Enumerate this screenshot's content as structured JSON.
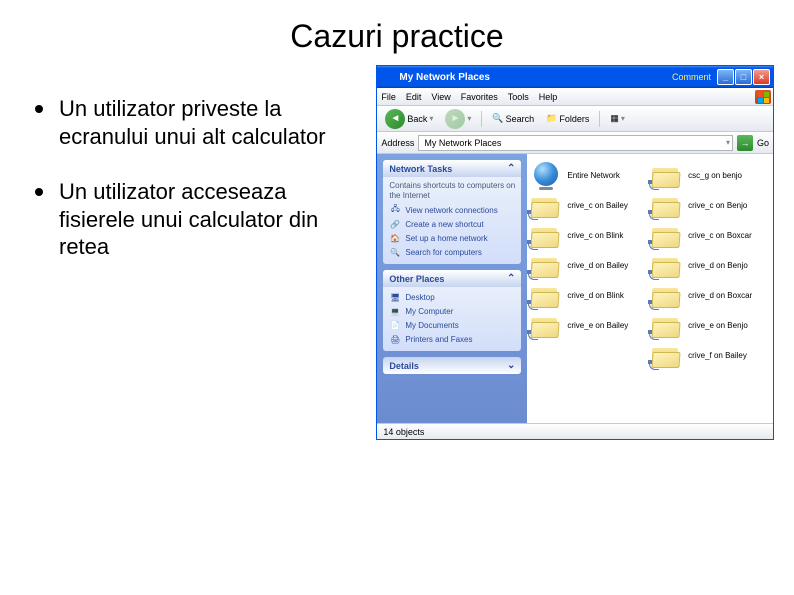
{
  "slide": {
    "title": "Cazuri practice",
    "bullets": [
      "Un utilizator priveste la ecranului unui alt calculator",
      "Un utilizator acceseaza fisierele unui calculator din retea"
    ]
  },
  "window": {
    "title": "My Network Places",
    "comment": "Comment",
    "min": "_",
    "max": "□",
    "close": "×"
  },
  "menubar": [
    "File",
    "Edit",
    "View",
    "Favorites",
    "Tools",
    "Help"
  ],
  "toolbar": {
    "back": "Back",
    "search": "Search",
    "folders": "Folders"
  },
  "addressbar": {
    "label": "Address",
    "value": "My Network Places",
    "go": "Go"
  },
  "sidebar": {
    "network_tasks": {
      "title": "Network Tasks",
      "desc": "Contains shortcuts to computers on the Internet",
      "links": [
        "View network connections",
        "Create a new shortcut",
        "Set up a home network",
        "Search for computers"
      ]
    },
    "other_places": {
      "title": "Other Places",
      "links": [
        "Desktop",
        "My Computer",
        "My Documents",
        "Printers and Faxes"
      ]
    },
    "details": {
      "title": "Details"
    }
  },
  "files": [
    {
      "name": "Entire Network",
      "type": "globe"
    },
    {
      "name": "csc_g on benjo",
      "type": "netfolder"
    },
    {
      "name": "crive_c on Bailey",
      "type": "netfolder"
    },
    {
      "name": "crive_c on Benjo",
      "type": "netfolder"
    },
    {
      "name": "crive_c on Blink",
      "type": "netfolder"
    },
    {
      "name": "crive_c on Boxcar",
      "type": "netfolder"
    },
    {
      "name": "crive_d on Bailey",
      "type": "netfolder"
    },
    {
      "name": "crive_d on Benjo",
      "type": "netfolder"
    },
    {
      "name": "crive_d on Blink",
      "type": "netfolder"
    },
    {
      "name": "crive_d on Boxcar",
      "type": "netfolder"
    },
    {
      "name": "crive_e on Bailey",
      "type": "netfolder"
    },
    {
      "name": "crive_e on Benjo",
      "type": "netfolder"
    },
    {
      "name": "",
      "type": "empty"
    },
    {
      "name": "crive_f on Bailey",
      "type": "netfolder"
    }
  ],
  "statusbar": {
    "text": "14 objects"
  }
}
